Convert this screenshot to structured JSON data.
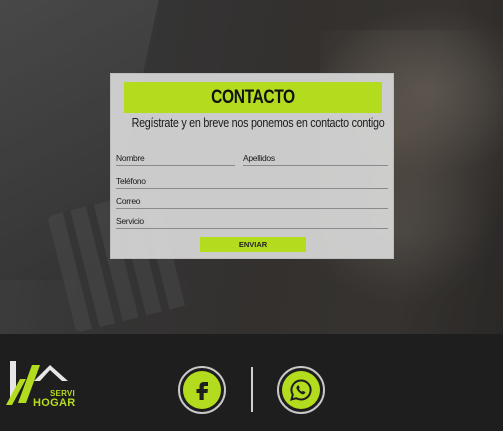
{
  "contact_form": {
    "title": "CONTACTO",
    "subtitle": "Regístrate y en breve nos ponemos en contacto contigo",
    "fields": {
      "nombre": "Nombre",
      "apellidos": "Apellidos",
      "telefono": "Teléfono",
      "correo": "Correo",
      "servicio": "Servicio"
    },
    "submit_label": "ENVIAR"
  },
  "footer": {
    "logo": {
      "line1": "SERVI",
      "line2": "HOGAR"
    },
    "social": [
      {
        "icon": "facebook-icon"
      },
      {
        "icon": "whatsapp-icon"
      }
    ]
  },
  "colors": {
    "accent": "#b4dc1f",
    "footer_bg": "#1e1e1e",
    "card_bg": "#d7d7d7"
  }
}
